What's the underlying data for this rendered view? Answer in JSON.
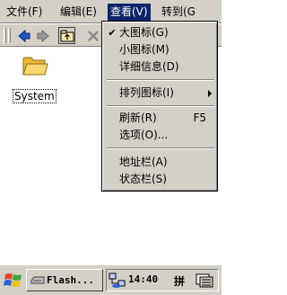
{
  "menubar": {
    "items": [
      {
        "label": "文件(F)"
      },
      {
        "label": "编辑(E)"
      },
      {
        "label": "查看(V)"
      },
      {
        "label": "转到(G"
      }
    ]
  },
  "content": {
    "files": [
      {
        "label": "System"
      }
    ]
  },
  "view_menu": {
    "items": [
      {
        "label": "大图标(G)",
        "checked": "✔",
        "shortcut": ""
      },
      {
        "label": "小图标(M)",
        "checked": "",
        "shortcut": ""
      },
      {
        "label": "详细信息(D)",
        "checked": "",
        "shortcut": ""
      },
      {
        "label": "排列图标(I)",
        "checked": "",
        "shortcut": ""
      },
      {
        "label": "刷新(R)",
        "checked": "",
        "shortcut": "F5"
      },
      {
        "label": "选项(O)...",
        "checked": "",
        "shortcut": ""
      },
      {
        "label": "地址栏(A)",
        "checked": "",
        "shortcut": ""
      },
      {
        "label": "状态栏(S)",
        "checked": "",
        "shortcut": ""
      }
    ]
  },
  "taskbar": {
    "task_label": "Flash...",
    "clock": "14:40",
    "ime": "拼"
  },
  "colors": {
    "chrome": "#d4d0c8",
    "highlight": "#0a246a",
    "folder": "#f2c94c"
  }
}
